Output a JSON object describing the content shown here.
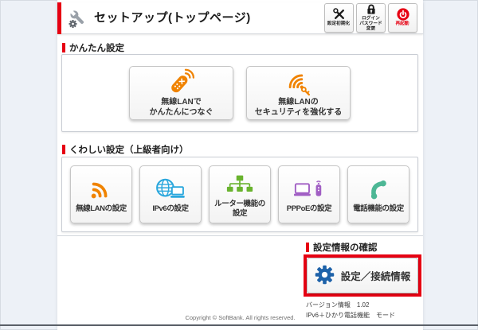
{
  "header": {
    "title": "セットアップ(トップページ)",
    "buttons": [
      {
        "label": "設定初期化",
        "icon": "tools-icon"
      },
      {
        "label": "ログイン\nパスワード変更",
        "icon": "lock-icon"
      },
      {
        "label": "再起動",
        "icon": "power-icon"
      }
    ]
  },
  "sections": {
    "easy": {
      "title": "かんたん設定",
      "buttons": [
        {
          "label": "無線LANで\nかんたんにつなぐ",
          "icon": "remote-wps-icon",
          "color": "#f08300"
        },
        {
          "label": "無線LANの\nセキュリティを強化する",
          "icon": "wifi-key-icon",
          "color": "#f08300"
        }
      ]
    },
    "advanced": {
      "title": "くわしい設定（上級者向け）",
      "buttons": [
        {
          "label": "無線LANの設定",
          "icon": "wifi-icon",
          "color": "#f08300"
        },
        {
          "label": "IPv6の設定",
          "icon": "globe-laptop-icon",
          "color": "#2aa7dd"
        },
        {
          "label": "ルーター機能の\n設定",
          "icon": "network-tree-icon",
          "color": "#69b32e"
        },
        {
          "label": "PPPoEの設定",
          "icon": "laptop-router-icon",
          "color": "#a15fc4"
        },
        {
          "label": "電話機能の設定",
          "icon": "phone-icon",
          "color": "#4db795"
        }
      ]
    },
    "info": {
      "title": "設定情報の確認",
      "button": {
        "label": "設定／接続情報",
        "icon": "gear-icon",
        "highlighted": true,
        "highlight_color": "#e60012"
      }
    }
  },
  "footer": {
    "version_line": "バージョン情報　1.02",
    "mode_line": "IPv6＋ひかり電話機能　モード",
    "copyright": "Copyright © SoftBank. All rights reserved."
  },
  "colors": {
    "accent_red": "#e60012",
    "page_background": "#edf1f7",
    "info_gear_blue": "#1e62a9"
  }
}
